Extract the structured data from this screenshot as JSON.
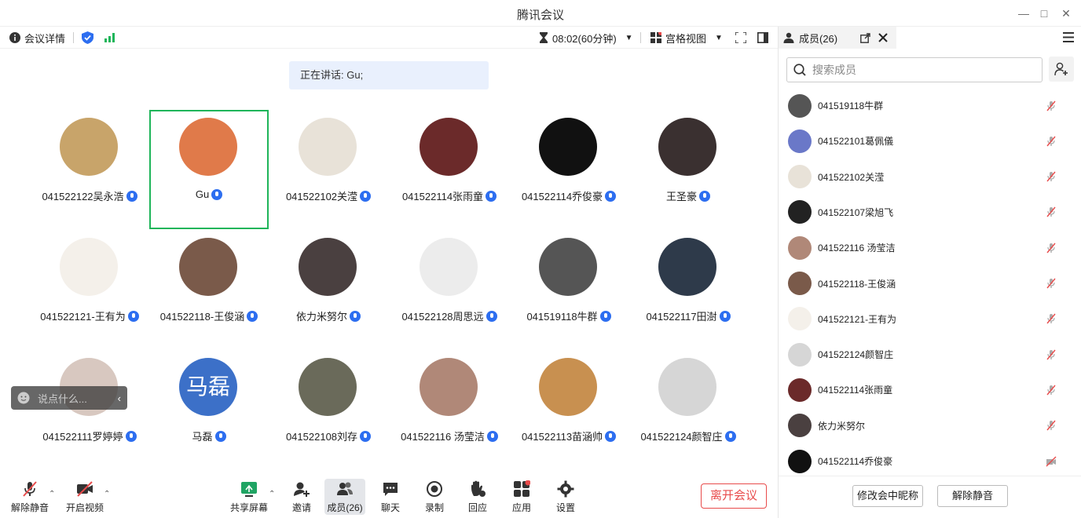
{
  "window": {
    "title": "腾讯会议"
  },
  "meeting_bar": {
    "details_label": "会议详情",
    "timer": "08:02(60分钟)",
    "view_label": "宫格视图"
  },
  "speaking": {
    "text": "正在讲话: Gu;"
  },
  "tiles": [
    {
      "name": "041522122吴永浩",
      "color": "#c8a46a"
    },
    {
      "name": "Gu",
      "color": "#e07a4a"
    },
    {
      "name": "041522102关滢",
      "color": "#e8e2d8"
    },
    {
      "name": "041522114张雨童",
      "color": "#6b2a2a"
    },
    {
      "name": "041522114乔俊豪",
      "color": "#111111"
    },
    {
      "name": "王圣豪",
      "color": "#3a3030"
    },
    {
      "name": "041522121-王有为",
      "color": "#f4f0ea"
    },
    {
      "name": "041522118-王俊涵",
      "color": "#7a5a4a"
    },
    {
      "name": "依力米努尔",
      "color": "#4a4040"
    },
    {
      "name": "041522128周思远",
      "color": "#ececec"
    },
    {
      "name": "041519118牛群",
      "color": "#555555"
    },
    {
      "name": "041522117田澍",
      "color": "#2e3a4a"
    },
    {
      "name": "041522111罗婷婷",
      "color": "#d8c8c0"
    },
    {
      "name": "马磊",
      "color": "#3c70c8",
      "text": "马磊"
    },
    {
      "name": "041522108刘存",
      "color": "#6a6a5a"
    },
    {
      "name": "041522116 汤莹洁",
      "color": "#b08878"
    },
    {
      "name": "041522113苗涵帅",
      "color": "#c89050"
    },
    {
      "name": "041522124颜智庄",
      "color": "#d6d6d6"
    }
  ],
  "chat_input": {
    "placeholder": "说点什么..."
  },
  "toolbar": {
    "unmute": "解除静音",
    "start_video": "开启视频",
    "share": "共享屏幕",
    "invite": "邀请",
    "members": "成员(26)",
    "chat": "聊天",
    "record": "录制",
    "reactions": "回应",
    "apps": "应用",
    "settings": "设置",
    "leave": "离开会议"
  },
  "panel": {
    "title": "成员(26)",
    "search_placeholder": "搜索成员",
    "members": [
      {
        "name": "041519118牛群",
        "color": "#555555"
      },
      {
        "name": "041522101葛佩儀",
        "color": "#6a78c8"
      },
      {
        "name": "041522102关滢",
        "color": "#e8e2d8"
      },
      {
        "name": "041522107梁旭飞",
        "color": "#222222"
      },
      {
        "name": "041522116 汤莹洁",
        "color": "#b08878"
      },
      {
        "name": "041522118-王俊涵",
        "color": "#7a5a4a"
      },
      {
        "name": "041522121-王有为",
        "color": "#f4f0ea"
      },
      {
        "name": "041522124颜智庄",
        "color": "#d6d6d6"
      },
      {
        "name": "041522114张雨童",
        "color": "#6b2a2a"
      },
      {
        "name": "依力米努尔",
        "color": "#4a4040"
      },
      {
        "name": "041522114乔俊豪",
        "color": "#111111"
      }
    ],
    "rename_button": "修改会中昵称",
    "unmute_button": "解除静音"
  }
}
